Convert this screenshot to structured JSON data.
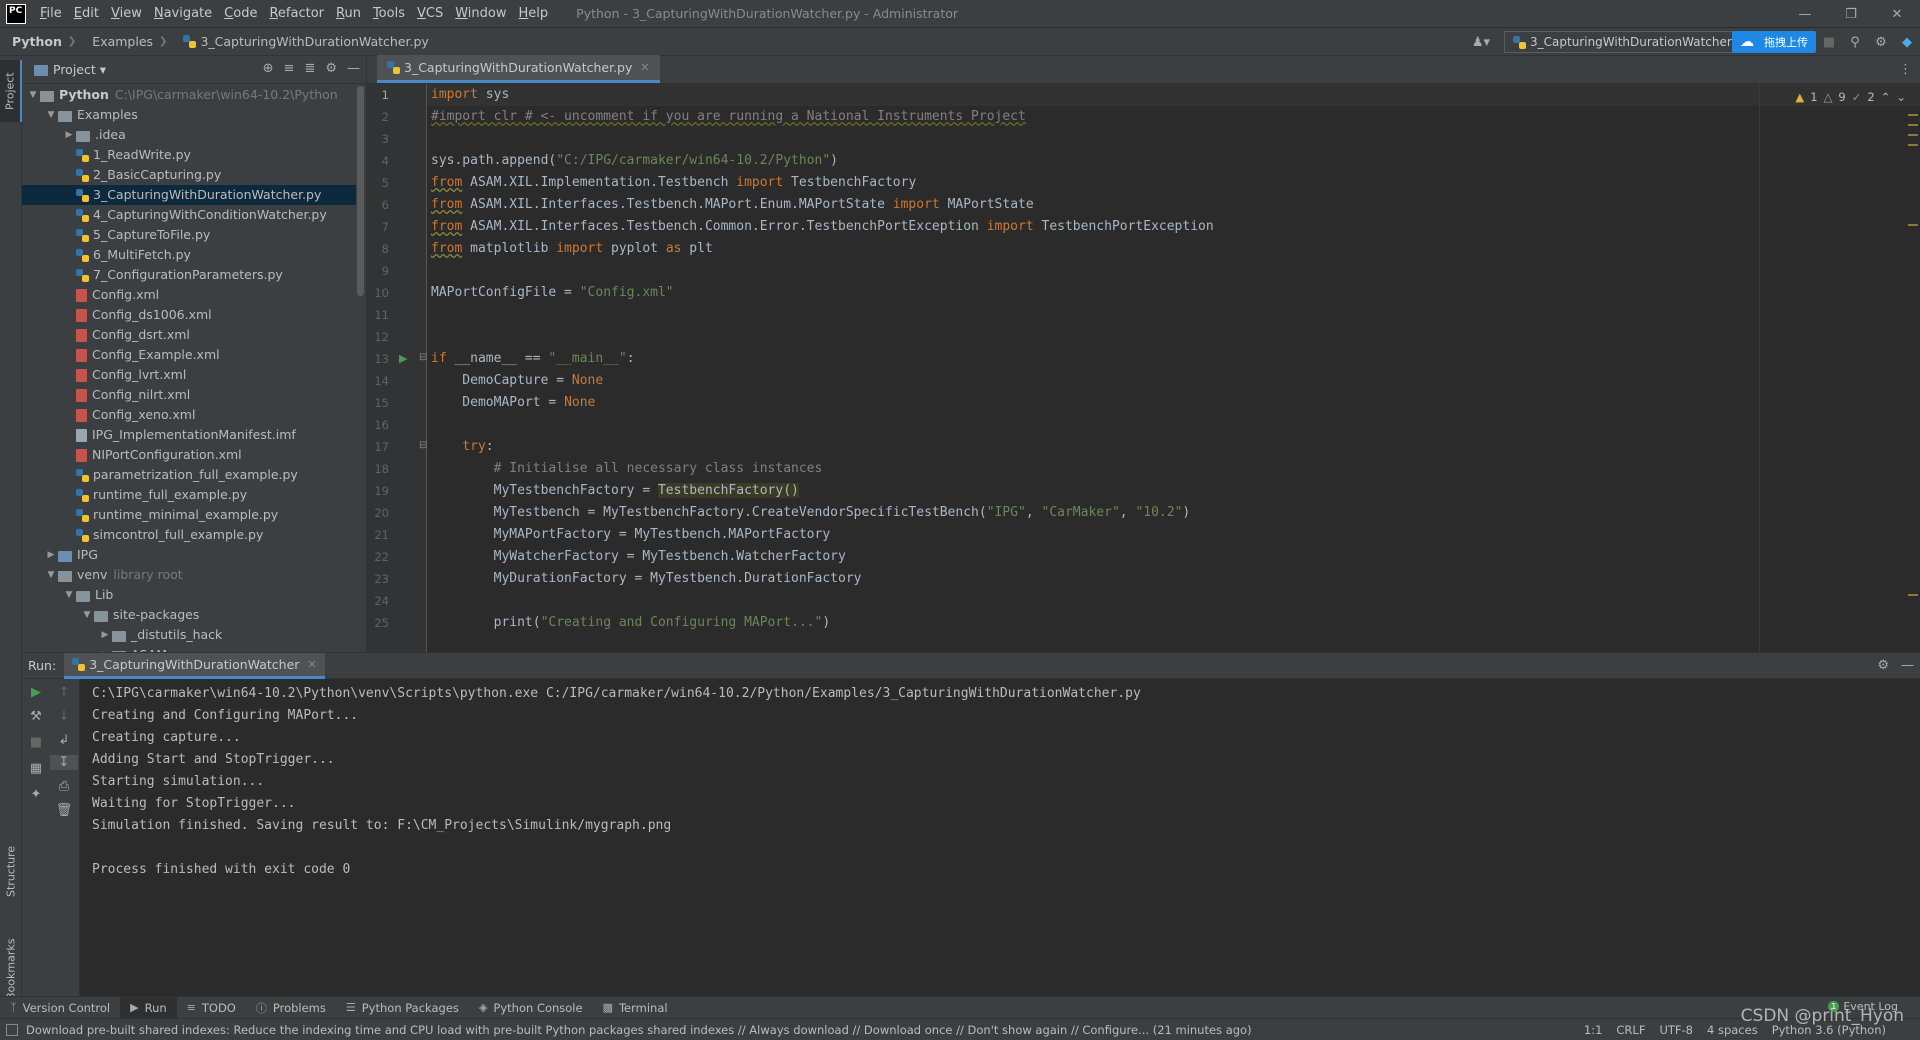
{
  "menubar": {
    "logo": "PC",
    "items": [
      {
        "u": "F",
        "rest": "ile"
      },
      {
        "u": "E",
        "rest": "dit"
      },
      {
        "u": "V",
        "rest": "iew"
      },
      {
        "u": "N",
        "rest": "avigate"
      },
      {
        "u": "C",
        "rest": "ode"
      },
      {
        "u": "R",
        "rest": "efactor"
      },
      {
        "u": "R",
        "rest": "un"
      },
      {
        "u": "T",
        "rest": "ools"
      },
      {
        "u": "V",
        "rest": "CS"
      },
      {
        "u": "W",
        "rest": "indow"
      },
      {
        "u": "H",
        "rest": "elp"
      }
    ],
    "window_title": "Python - 3_CapturingWithDurationWatcher.py - Administrator"
  },
  "navbar": {
    "breadcrumbs": [
      "Python",
      "Examples",
      "3_CapturingWithDurationWatcher.py"
    ],
    "run_config": "3_CapturingWithDurationWatcher",
    "upload_label": "拖拽上传"
  },
  "left_stripe": {
    "project": "Project",
    "structure": "Structure",
    "bookmarks": "Bookmarks"
  },
  "project": {
    "title": "Project",
    "tree": [
      {
        "depth": 0,
        "arrow": "open",
        "icon": "folder",
        "label": "Python",
        "bold": true,
        "hint": "C:\\IPG\\carmaker\\win64-10.2\\Python"
      },
      {
        "depth": 1,
        "arrow": "open",
        "icon": "folder",
        "label": "Examples"
      },
      {
        "depth": 2,
        "arrow": "closed",
        "icon": "folder",
        "label": ".idea"
      },
      {
        "depth": 2,
        "arrow": "none",
        "icon": "py",
        "label": "1_ReadWrite.py"
      },
      {
        "depth": 2,
        "arrow": "none",
        "icon": "py",
        "label": "2_BasicCapturing.py"
      },
      {
        "depth": 2,
        "arrow": "none",
        "icon": "py",
        "label": "3_CapturingWithDurationWatcher.py",
        "selected": true
      },
      {
        "depth": 2,
        "arrow": "none",
        "icon": "py",
        "label": "4_CapturingWithConditionWatcher.py"
      },
      {
        "depth": 2,
        "arrow": "none",
        "icon": "py",
        "label": "5_CaptureToFile.py"
      },
      {
        "depth": 2,
        "arrow": "none",
        "icon": "py",
        "label": "6_MultiFetch.py"
      },
      {
        "depth": 2,
        "arrow": "none",
        "icon": "py",
        "label": "7_ConfigurationParameters.py"
      },
      {
        "depth": 2,
        "arrow": "none",
        "icon": "xml",
        "label": "Config.xml"
      },
      {
        "depth": 2,
        "arrow": "none",
        "icon": "xml",
        "label": "Config_ds1006.xml"
      },
      {
        "depth": 2,
        "arrow": "none",
        "icon": "xml",
        "label": "Config_dsrt.xml"
      },
      {
        "depth": 2,
        "arrow": "none",
        "icon": "xml",
        "label": "Config_Example.xml"
      },
      {
        "depth": 2,
        "arrow": "none",
        "icon": "xml",
        "label": "Config_lvrt.xml"
      },
      {
        "depth": 2,
        "arrow": "none",
        "icon": "xml",
        "label": "Config_nilrt.xml"
      },
      {
        "depth": 2,
        "arrow": "none",
        "icon": "xml",
        "label": "Config_xeno.xml"
      },
      {
        "depth": 2,
        "arrow": "none",
        "icon": "imf",
        "label": "IPG_ImplementationManifest.imf"
      },
      {
        "depth": 2,
        "arrow": "none",
        "icon": "xml",
        "label": "NIPortConfiguration.xml"
      },
      {
        "depth": 2,
        "arrow": "none",
        "icon": "py",
        "label": "parametrization_full_example.py"
      },
      {
        "depth": 2,
        "arrow": "none",
        "icon": "py",
        "label": "runtime_full_example.py"
      },
      {
        "depth": 2,
        "arrow": "none",
        "icon": "py",
        "label": "runtime_minimal_example.py"
      },
      {
        "depth": 2,
        "arrow": "none",
        "icon": "py",
        "label": "simcontrol_full_example.py"
      },
      {
        "depth": 1,
        "arrow": "closed",
        "icon": "folder-blue",
        "label": "IPG"
      },
      {
        "depth": 1,
        "arrow": "open",
        "icon": "folder",
        "label": "venv",
        "hint": "library root"
      },
      {
        "depth": 2,
        "arrow": "open",
        "icon": "folder",
        "label": "Lib"
      },
      {
        "depth": 3,
        "arrow": "open",
        "icon": "folder",
        "label": "site-packages"
      },
      {
        "depth": 4,
        "arrow": "closed",
        "icon": "folder",
        "label": "_distutils_hack"
      },
      {
        "depth": 4,
        "arrow": "closed",
        "icon": "folder",
        "label": "ASAM"
      }
    ]
  },
  "editor": {
    "tab_label": "3_CapturingWithDurationWatcher.py",
    "inspections": {
      "warnings": "1",
      "weak": "9",
      "ok": "2"
    },
    "lines": [
      "1",
      "2",
      "3",
      "4",
      "5",
      "6",
      "7",
      "8",
      "9",
      "10",
      "11",
      "12",
      "13",
      "14",
      "15",
      "16",
      "17",
      "18",
      "19",
      "20",
      "21",
      "22",
      "23",
      "24",
      "25"
    ],
    "code": {
      "l1_kw": "import",
      "l1_rest": " sys",
      "l2": "#import clr # <- uncomment if you are running a National Instruments Project",
      "l4_a": "sys.path.append(",
      "l4_str": "\"C:/IPG/carmaker/win64-10.2/Python\"",
      "l4_b": ")",
      "l5_kw1": "from",
      "l5_a": " ASAM.XIL.Implementation.Testbench ",
      "l5_kw2": "import",
      "l5_b": " TestbenchFactory",
      "l6_kw1": "from",
      "l6_a": " ASAM.XIL.Interfaces.Testbench.MAPort.Enum.MAPortState ",
      "l6_kw2": "import",
      "l6_b": " MAPortState",
      "l7_kw1": "from",
      "l7_a": " ASAM.XIL.Interfaces.Testbench.Common.Error.TestbenchPortException ",
      "l7_kw2": "import",
      "l7_b": " TestbenchPortException",
      "l8_kw1": "from",
      "l8_a": " matplotlib ",
      "l8_kw2": "import",
      "l8_b": " pyplot ",
      "l8_kw3": "as",
      "l8_c": " plt",
      "l10_a": "MAPortConfigFile = ",
      "l10_str": "\"Config.xml\"",
      "l13_kw": "if",
      "l13_a": " __name__ == ",
      "l13_str": "\"__main__\"",
      "l13_b": ":",
      "l14_a": "    DemoCapture = ",
      "l14_none": "None",
      "l15_a": "    DemoMAPort = ",
      "l15_none": "None",
      "l17_kw": "    try",
      "l17_b": ":",
      "l18": "        # Initialise all necessary class instances",
      "l19_a": "        MyTestbenchFactory = ",
      "l19_hl": "TestbenchFactory()",
      "l20_a": "        MyTestbench = MyTestbenchFactory.CreateVendorSpecificTestBench(",
      "l20_s1": "\"IPG\"",
      "l20_c1": ", ",
      "l20_s2": "\"CarMaker\"",
      "l20_c2": ", ",
      "l20_s3": "\"10.2\"",
      "l20_b": ")",
      "l21": "        MyMAPortFactory = MyTestbench.MAPortFactory",
      "l22": "        MyWatcherFactory = MyTestbench.WatcherFactory",
      "l23": "        MyDurationFactory = MyTestbench.DurationFactory",
      "l25_a": "        print(",
      "l25_str": "\"Creating and Configuring MAPort...\"",
      "l25_b": ")"
    }
  },
  "run": {
    "label": "Run:",
    "tab_label": "3_CapturingWithDurationWatcher",
    "output": [
      "C:\\IPG\\carmaker\\win64-10.2\\Python\\venv\\Scripts\\python.exe C:/IPG/carmaker/win64-10.2/Python/Examples/3_CapturingWithDurationWatcher.py",
      "Creating and Configuring MAPort...",
      "Creating capture...",
      "Adding Start and StopTrigger...",
      "Starting simulation...",
      "Waiting for StopTrigger...",
      "Simulation finished. Saving result to: F:\\CM_Projects\\Simulink/mygraph.png",
      "",
      "Process finished with exit code 0"
    ]
  },
  "bottom_tabs": [
    "Version Control",
    "Run",
    "TODO",
    "Problems",
    "Python Packages",
    "Python Console",
    "Terminal"
  ],
  "event_log": {
    "count": "1",
    "label": "Event Log"
  },
  "status": {
    "message": "Download pre-built shared indexes: Reduce the indexing time and CPU load with pre-built Python packages shared indexes // Always download // Download once // Don't show again // Configure... (21 minutes ago)",
    "position": "1:1",
    "line_sep": "CRLF",
    "encoding": "UTF-8",
    "indent": "4 spaces",
    "interpreter": "Python 3.6 (Python)"
  },
  "watermark": "CSDN @print_Hyon"
}
